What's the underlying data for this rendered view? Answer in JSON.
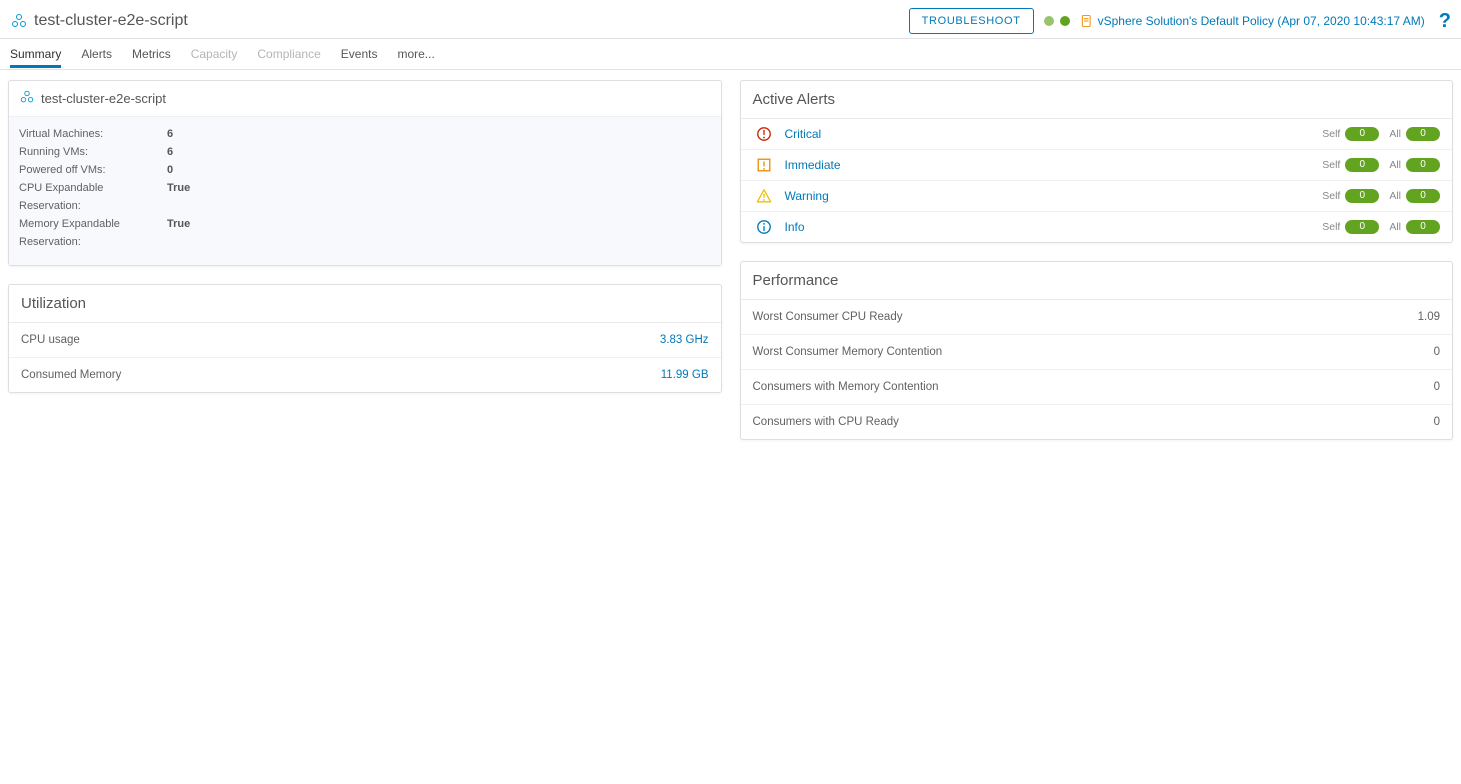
{
  "header": {
    "title": "test-cluster-e2e-script",
    "troubleshoot_label": "TROUBLESHOOT",
    "policy_text": "vSphere Solution's Default Policy (Apr 07, 2020 10:43:17 AM)"
  },
  "tabs": [
    {
      "label": "Summary",
      "state": "active"
    },
    {
      "label": "Alerts",
      "state": "normal"
    },
    {
      "label": "Metrics",
      "state": "normal"
    },
    {
      "label": "Capacity",
      "state": "disabled"
    },
    {
      "label": "Compliance",
      "state": "disabled"
    },
    {
      "label": "Events",
      "state": "normal"
    },
    {
      "label": "more...",
      "state": "more"
    }
  ],
  "info_card": {
    "title": "test-cluster-e2e-script",
    "rows": [
      {
        "k": "Virtual Machines:",
        "v": "6"
      },
      {
        "k": "Running VMs:",
        "v": "6"
      },
      {
        "k": "Powered off VMs:",
        "v": "0"
      },
      {
        "k": "CPU Expandable Reservation:",
        "v": "True"
      },
      {
        "k": "Memory Expandable Reservation:",
        "v": "True"
      }
    ]
  },
  "utilization": {
    "title": "Utilization",
    "rows": [
      {
        "label": "CPU usage",
        "value": "3.83 GHz"
      },
      {
        "label": "Consumed Memory",
        "value": "11.99 GB"
      }
    ]
  },
  "alerts": {
    "title": "Active Alerts",
    "self_label": "Self",
    "all_label": "All",
    "levels": [
      {
        "name": "Critical",
        "color": "#c92100",
        "icon": "critical",
        "self": "0",
        "all": "0"
      },
      {
        "name": "Immediate",
        "color": "#eb8d00",
        "icon": "immediate",
        "self": "0",
        "all": "0"
      },
      {
        "name": "Warning",
        "color": "#efc006",
        "icon": "warning",
        "self": "0",
        "all": "0"
      },
      {
        "name": "Info",
        "color": "#0079b8",
        "icon": "info",
        "self": "0",
        "all": "0"
      }
    ]
  },
  "performance": {
    "title": "Performance",
    "rows": [
      {
        "label": "Worst Consumer CPU Ready",
        "value": "1.09"
      },
      {
        "label": "Worst Consumer Memory Contention",
        "value": "0"
      },
      {
        "label": "Consumers with Memory Contention",
        "value": "0"
      },
      {
        "label": "Consumers with CPU Ready",
        "value": "0"
      }
    ]
  }
}
